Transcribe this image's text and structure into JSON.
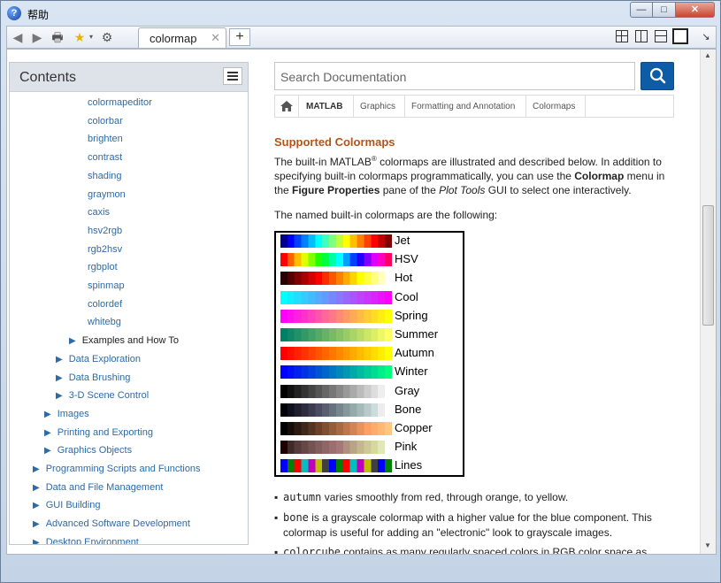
{
  "window": {
    "title": "帮助",
    "app_icon_glyph": "?",
    "controls": {
      "minimize": "—",
      "maximize": "□",
      "close": "✕"
    }
  },
  "toolbar": {
    "back_icon": "◀",
    "forward_icon": "▶",
    "print_icon": "🖶",
    "favorites_icon": "★",
    "settings_icon": "⚙",
    "tab_label": "colormap",
    "tab_close": "✕",
    "new_tab": "+",
    "pin_icon": "↘"
  },
  "sidebar": {
    "title": "Contents",
    "items": [
      {
        "label": "colormapeditor",
        "level": 4,
        "arrow": false
      },
      {
        "label": "colorbar",
        "level": 4,
        "arrow": false
      },
      {
        "label": "brighten",
        "level": 4,
        "arrow": false
      },
      {
        "label": "contrast",
        "level": 4,
        "arrow": false
      },
      {
        "label": "shading",
        "level": 4,
        "arrow": false
      },
      {
        "label": "graymon",
        "level": 4,
        "arrow": false
      },
      {
        "label": "caxis",
        "level": 4,
        "arrow": false
      },
      {
        "label": "hsv2rgb",
        "level": 4,
        "arrow": false
      },
      {
        "label": "rgb2hsv",
        "level": 4,
        "arrow": false
      },
      {
        "label": "rgbplot",
        "level": 4,
        "arrow": false
      },
      {
        "label": "spinmap",
        "level": 4,
        "arrow": false
      },
      {
        "label": "colordef",
        "level": 4,
        "arrow": false
      },
      {
        "label": "whitebg",
        "level": 4,
        "arrow": false
      },
      {
        "label": "Examples and How To",
        "level": 3,
        "arrow": true,
        "dark": true
      },
      {
        "label": "Data Exploration",
        "level": 2,
        "arrow": true
      },
      {
        "label": "Data Brushing",
        "level": 2,
        "arrow": true
      },
      {
        "label": "3-D Scene Control",
        "level": 2,
        "arrow": true
      },
      {
        "label": "Images",
        "level": 1,
        "arrow": true
      },
      {
        "label": "Printing and Exporting",
        "level": 1,
        "arrow": true
      },
      {
        "label": "Graphics Objects",
        "level": 1,
        "arrow": true
      },
      {
        "label": "Programming Scripts and Functions",
        "level": 0,
        "arrow": true
      },
      {
        "label": "Data and File Management",
        "level": 0,
        "arrow": true
      },
      {
        "label": "GUI Building",
        "level": 0,
        "arrow": true
      },
      {
        "label": "Advanced Software Development",
        "level": 0,
        "arrow": true
      },
      {
        "label": "Desktop Environment",
        "level": 0,
        "arrow": true
      }
    ]
  },
  "search": {
    "placeholder": "Search Documentation"
  },
  "breadcrumb": [
    "MATLAB",
    "Graphics",
    "Formatting and Annotation",
    "Colormaps"
  ],
  "article": {
    "heading": "Supported Colormaps",
    "intro_1": "The built-in MATLAB",
    "registered": "®",
    "intro_2": " colormaps are illustrated and described below. In addition to specifying built-in colormaps programmatically, you can use the ",
    "intro_colormap": "Colormap",
    "intro_3": " menu in the ",
    "intro_figprops": "Figure Properties",
    "intro_4": " pane of the ",
    "intro_plottools": "Plot Tools",
    "intro_5": " GUI to select one interactively.",
    "named_text": "The named built-in colormaps are the following:",
    "colormaps": [
      {
        "name": "Jet",
        "colors": [
          "#00008f",
          "#0000ff",
          "#0040ff",
          "#0080ff",
          "#00bfff",
          "#00ffff",
          "#40ffbf",
          "#80ff80",
          "#bfff40",
          "#ffff00",
          "#ffbf00",
          "#ff8000",
          "#ff4000",
          "#ff0000",
          "#bf0000",
          "#800000"
        ]
      },
      {
        "name": "HSV",
        "colors": [
          "#ff0000",
          "#ff6000",
          "#ffbf00",
          "#dfff00",
          "#80ff00",
          "#20ff00",
          "#00ff40",
          "#00ffa0",
          "#00ffff",
          "#00a0ff",
          "#0040ff",
          "#2000ff",
          "#8000ff",
          "#df00ff",
          "#ff00bf",
          "#ff0060"
        ]
      },
      {
        "name": "Hot",
        "colors": [
          "#2b0000",
          "#550000",
          "#800000",
          "#aa0000",
          "#d50000",
          "#ff0000",
          "#ff2b00",
          "#ff5500",
          "#ff8000",
          "#ffaa00",
          "#ffd500",
          "#ffff00",
          "#ffff40",
          "#ffff80",
          "#ffffbf",
          "#ffffff"
        ]
      },
      {
        "name": "Cool",
        "colors": [
          "#00ffff",
          "#11eeff",
          "#22ddff",
          "#33ccff",
          "#44bbff",
          "#55aaff",
          "#6699ff",
          "#7788ff",
          "#8877ff",
          "#9966ff",
          "#aa55ff",
          "#bb44ff",
          "#cc33ff",
          "#dd22ff",
          "#ee11ff",
          "#ff00ff"
        ]
      },
      {
        "name": "Spring",
        "colors": [
          "#ff00ff",
          "#ff11ee",
          "#ff22dd",
          "#ff33cc",
          "#ff44bb",
          "#ff55aa",
          "#ff6699",
          "#ff7788",
          "#ff8877",
          "#ff9966",
          "#ffaa55",
          "#ffbb44",
          "#ffcc33",
          "#ffdd22",
          "#ffee11",
          "#ffff00"
        ]
      },
      {
        "name": "Summer",
        "colors": [
          "#008066",
          "#118866",
          "#229166",
          "#339966",
          "#44a266",
          "#55aa66",
          "#66b366",
          "#77bb66",
          "#88c466",
          "#99cc66",
          "#aad566",
          "#bbdd66",
          "#cce666",
          "#ddee66",
          "#eef766",
          "#ffff66"
        ]
      },
      {
        "name": "Autumn",
        "colors": [
          "#ff0000",
          "#ff1100",
          "#ff2200",
          "#ff3300",
          "#ff4400",
          "#ff5500",
          "#ff6600",
          "#ff7700",
          "#ff8800",
          "#ff9900",
          "#ffaa00",
          "#ffbb00",
          "#ffcc00",
          "#ffdd00",
          "#ffee00",
          "#ffff00"
        ]
      },
      {
        "name": "Winter",
        "colors": [
          "#0000ff",
          "#0011f7",
          "#0022ee",
          "#0033e6",
          "#0044dd",
          "#0055d5",
          "#0066cc",
          "#0077c4",
          "#0088bb",
          "#0099b3",
          "#00aaaa",
          "#00bba2",
          "#00cc99",
          "#00dd91",
          "#00ee88",
          "#00ff80"
        ]
      },
      {
        "name": "Gray",
        "colors": [
          "#000000",
          "#111111",
          "#222222",
          "#333333",
          "#444444",
          "#555555",
          "#666666",
          "#777777",
          "#888888",
          "#999999",
          "#aaaaaa",
          "#bbbbbb",
          "#cccccc",
          "#dddddd",
          "#eeeeee",
          "#ffffff"
        ]
      },
      {
        "name": "Bone",
        "colors": [
          "#00000b",
          "#0f0f1d",
          "#1e1e2e",
          "#2d2d40",
          "#3c3c51",
          "#4b4b63",
          "#595f6f",
          "#68727e",
          "#77858c",
          "#86989b",
          "#95aaaa",
          "#a7baba",
          "#bacaca",
          "#ccdbdb",
          "#ededed",
          "#ffffff"
        ]
      },
      {
        "name": "Copper",
        "colors": [
          "#000000",
          "#150d08",
          "#2a1a11",
          "#3f2819",
          "#543522",
          "#6a422a",
          "#7f4f32",
          "#945d3b",
          "#a96a43",
          "#be774c",
          "#d38454",
          "#e9925c",
          "#fe9f65",
          "#ffac6d",
          "#ffb975",
          "#ffc77f"
        ]
      },
      {
        "name": "Pink",
        "colors": [
          "#1e0000",
          "#3f2a2a",
          "#553b3b",
          "#664848",
          "#755353",
          "#825d5d",
          "#8f6666",
          "#9b6f6f",
          "#a67777",
          "#b08f7f",
          "#bba486",
          "#c4b78d",
          "#cec994",
          "#d7d99a",
          "#dfe8b6",
          "#ffffff"
        ]
      },
      {
        "name": "Lines",
        "colors": [
          "#0000ff",
          "#008000",
          "#ff0000",
          "#00bfbf",
          "#bf00bf",
          "#bfbf00",
          "#404040",
          "#0000ff",
          "#008000",
          "#ff0000",
          "#00bfbf",
          "#bf00bf",
          "#bfbf00",
          "#404040",
          "#0000ff",
          "#008000"
        ]
      }
    ],
    "bullets": [
      {
        "code": "autumn",
        "text": " varies smoothly from red, through orange, to yellow."
      },
      {
        "code": "bone",
        "text": " is a grayscale colormap with a higher value for the blue component. This colormap is useful for adding an \"electronic\" look to grayscale images."
      },
      {
        "code": "colorcube",
        "text": " contains as many regularly spaced colors in RGB color space as"
      }
    ]
  }
}
